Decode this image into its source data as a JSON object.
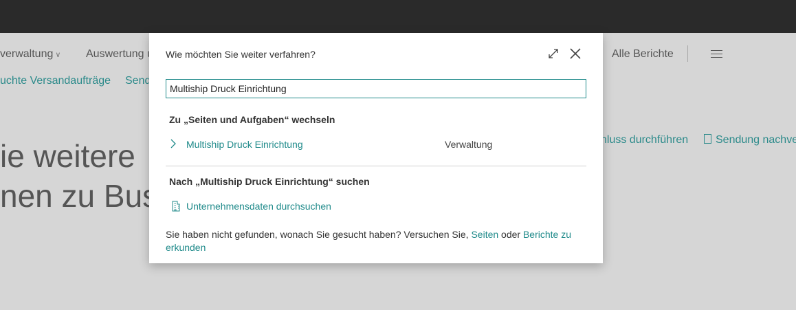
{
  "background": {
    "nav": [
      {
        "label": "verwaltung",
        "has_chevron": true
      },
      {
        "label": "Auswertung u",
        "has_chevron": false
      },
      {
        "label": "Alle Berichte",
        "has_chevron": false
      }
    ],
    "subnav": [
      "uchte Versandaufträge",
      "Send"
    ],
    "big_text": [
      "ie weitere",
      "nen zu Bus"
    ],
    "actions": [
      "nluss durchführen",
      "Sendung nachve"
    ]
  },
  "dialog": {
    "title": "Wie möchten Sie weiter verfahren?",
    "search_value": "Multiship Druck Einrichtung",
    "goto_heading": "Zu „Seiten und Aufgaben“ wechseln",
    "goto_results": [
      {
        "name": "Multiship Druck Einrichtung",
        "category": "Verwaltung"
      }
    ],
    "search_heading": "Nach „Multiship Druck Einrichtung“ suchen",
    "search_company_link": "Unternehmensdaten durchsuchen",
    "footer_text": "Sie haben nicht gefunden, wonach Sie gesucht haben? Versuchen Sie,",
    "footer_link1": "Seiten",
    "footer_or": "oder",
    "footer_link2": "Berichte zu erkunden"
  },
  "colors": {
    "accent": "#1f8a8a",
    "topbar": "#2a2a2a",
    "overlay": "#d6d6d6"
  },
  "icons": [
    "expand-icon",
    "close-icon",
    "chevron-right-icon",
    "building-icon",
    "menu-icon",
    "document-icon"
  ]
}
